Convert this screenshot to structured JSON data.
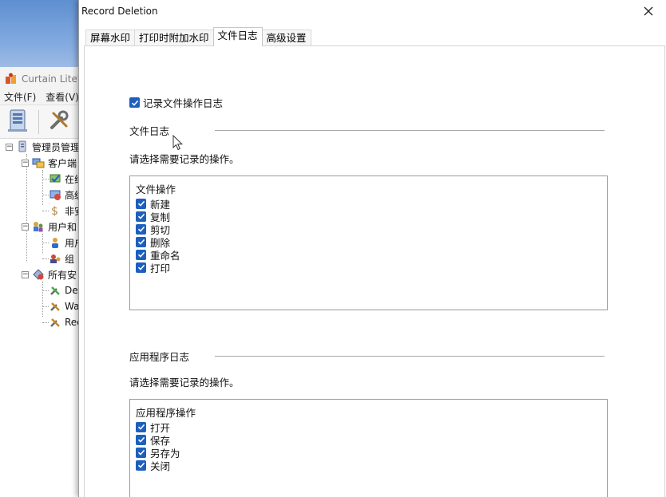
{
  "app": {
    "title": "Curtain Lite管",
    "menu": [
      "文件(F)",
      "查看(V)"
    ],
    "tree": [
      {
        "label": "管理员管理",
        "icon": "server-icon",
        "depth": 0
      },
      {
        "label": "客户端",
        "icon": "clients-icon",
        "depth": 1
      },
      {
        "label": "在线",
        "icon": "online-clients-icon",
        "depth": 2
      },
      {
        "label": "高级",
        "icon": "advanced-clients-icon",
        "depth": 2
      },
      {
        "label": "非安",
        "icon": "unsafe-clients-icon",
        "depth": 2
      },
      {
        "label": "用户和",
        "icon": "users-groups-icon",
        "depth": 1
      },
      {
        "label": "用户",
        "icon": "user-icon",
        "depth": 2
      },
      {
        "label": "组",
        "icon": "group-icon",
        "depth": 2
      },
      {
        "label": "所有安",
        "icon": "policies-icon",
        "depth": 1
      },
      {
        "label": "De",
        "icon": "tools-icon",
        "depth": 2
      },
      {
        "label": "Wa",
        "icon": "tools-icon",
        "depth": 2
      },
      {
        "label": "Rec",
        "icon": "tools-icon",
        "depth": 2
      }
    ]
  },
  "dialog": {
    "title": "Record Deletion",
    "tabs": [
      "屏幕水印",
      "打印时附加水印",
      "文件日志",
      "高级设置"
    ],
    "active_tab": 2,
    "record_file_log_label": "记录文件操作日志",
    "file_log": {
      "group_title": "文件日志",
      "instruction": "请选择需要记录的操作。",
      "list_header": "文件操作",
      "operations": [
        "新建",
        "复制",
        "剪切",
        "删除",
        "重命名",
        "打印"
      ]
    },
    "app_log": {
      "group_title": "应用程序日志",
      "instruction": "请选择需要记录的操作。",
      "list_header": "应用程序操作",
      "operations": [
        "打开",
        "保存",
        "另存为",
        "关闭"
      ]
    }
  },
  "colors": {
    "checkbox_accent": "#1d5fbe",
    "desktop_blue": "#6f9ad8"
  }
}
